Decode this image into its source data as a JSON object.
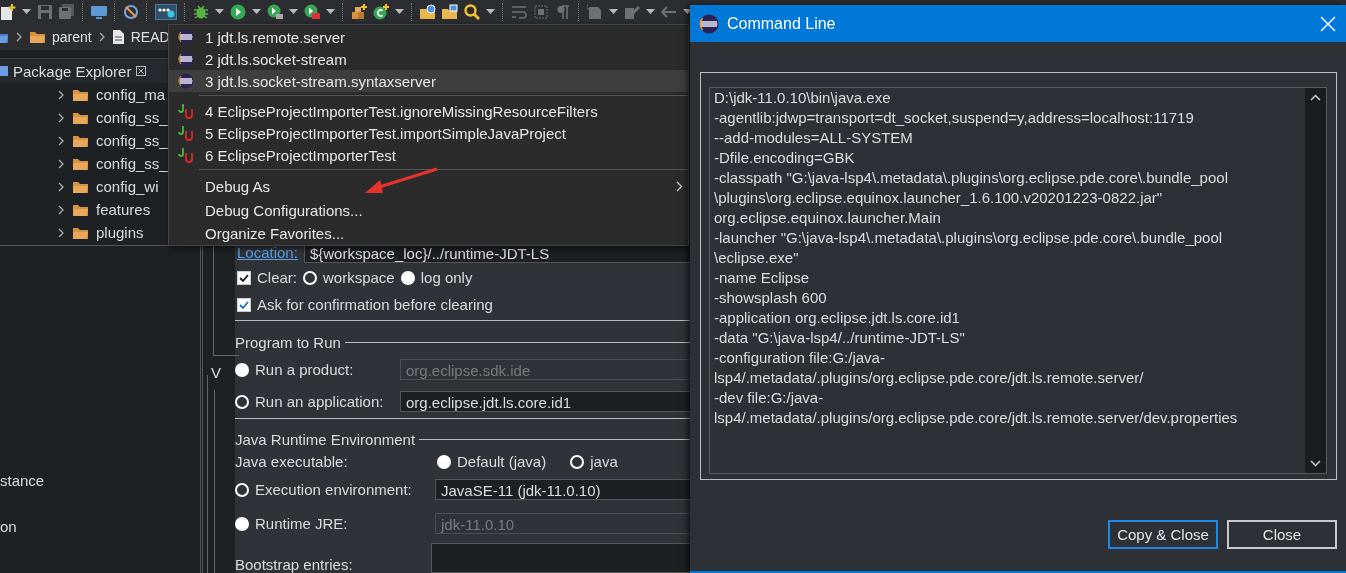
{
  "breadcrumb": [
    {
      "label": "parent",
      "kind": "folder"
    },
    {
      "label": "READ",
      "kind": "file"
    }
  ],
  "package_explorer": {
    "title": "Package Explorer",
    "items": [
      {
        "label": "config_ma"
      },
      {
        "label": "config_ss_"
      },
      {
        "label": "config_ss_"
      },
      {
        "label": "config_ss_"
      },
      {
        "label": "config_wi"
      },
      {
        "label": "features"
      },
      {
        "label": "plugins"
      }
    ]
  },
  "lower_panel": {
    "items": [
      {
        "label": "stance"
      },
      {
        "label": "on"
      }
    ]
  },
  "launch_config": {
    "location": {
      "label": "Location:",
      "value": "${workspace_loc}/../runtime-JDT-LS"
    },
    "clear": {
      "label": "Clear:",
      "checked": true,
      "options": [
        {
          "label": "workspace",
          "selected": false
        },
        {
          "label": "log only",
          "selected": true
        }
      ]
    },
    "confirm": {
      "label": "Ask for confirmation before clearing",
      "checked": true
    },
    "group_fragment": "V",
    "program": {
      "title": "Program to Run",
      "options": [
        {
          "label": "Run a product:",
          "selected": true,
          "value": "org.eclipse.sdk.ide",
          "disabled": true
        },
        {
          "label": "Run an application:",
          "selected": false,
          "value": "org.eclipse.jdt.ls.core.id1",
          "disabled": false
        }
      ]
    },
    "jre": {
      "title": "Java Runtime Environment",
      "executable": {
        "label": "Java executable:",
        "options": [
          {
            "label": "Default (java)",
            "selected": true
          },
          {
            "label": "java",
            "selected": false
          }
        ]
      },
      "options": [
        {
          "label": "Execution environment:",
          "selected": false,
          "value": "JavaSE-11 (jdk-11.0.10)",
          "disabled": false
        },
        {
          "label": "Runtime JRE:",
          "selected": true,
          "value": "jdk-11.0.10",
          "disabled": true
        }
      ]
    },
    "bootstrap": {
      "label": "Bootstrap entries:"
    }
  },
  "menu": {
    "items": [
      {
        "kind": "launch",
        "label": "1 jdt.ls.remote.server",
        "selected": false
      },
      {
        "kind": "launch",
        "label": "2 jdt.ls.socket-stream",
        "selected": false
      },
      {
        "kind": "launch",
        "label": "3 jdt.ls.socket-stream.syntaxserver",
        "selected": true
      },
      {
        "kind": "separator"
      },
      {
        "kind": "junit",
        "label": "4 EclipseProjectImporterTest.ignoreMissingResourceFilters",
        "selected": false
      },
      {
        "kind": "junit",
        "label": "5 EclipseProjectImporterTest.importSimpleJavaProject",
        "selected": false
      },
      {
        "kind": "junit",
        "label": "6 EclipseProjectImporterTest",
        "selected": false
      },
      {
        "kind": "separator"
      },
      {
        "kind": "submenu",
        "label": "Debug As",
        "selected": false
      },
      {
        "kind": "command",
        "label": "Debug Configurations...",
        "selected": false
      },
      {
        "kind": "command",
        "label": "Organize Favorites...",
        "selected": false
      }
    ]
  },
  "dialog": {
    "title": "Command Line",
    "lines": [
      "D:\\jdk-11.0.10\\bin\\java.exe",
      "-agentlib:jdwp=transport=dt_socket,suspend=y,address=localhost:11719",
      "--add-modules=ALL-SYSTEM",
      "-Dfile.encoding=GBK",
      "-classpath \"G:\\java-lsp4\\.metadata\\.plugins\\org.eclipse.pde.core\\.bundle_pool",
      "\\plugins\\org.eclipse.equinox.launcher_1.6.100.v20201223-0822.jar\"",
      "org.eclipse.equinox.launcher.Main",
      "-launcher \"G:\\java-lsp4\\.metadata\\.plugins\\org.eclipse.pde.core\\.bundle_pool",
      "\\eclipse.exe\"",
      "-name Eclipse",
      "-showsplash 600",
      "-application org.eclipse.jdt.ls.core.id1",
      "-data \"G:\\java-lsp4/../runtime-JDT-LS\"",
      "-configuration file:G:/java-",
      "lsp4/.metadata/.plugins/org.eclipse.pde.core/jdt.ls.remote.server/",
      "-dev file:G:/java-",
      "lsp4/.metadata/.plugins/org.eclipse.pde.core/jdt.ls.remote.server/dev.properties"
    ],
    "buttons": [
      {
        "label": "Copy & Close",
        "default": true
      },
      {
        "label": "Close",
        "default": false
      }
    ]
  }
}
